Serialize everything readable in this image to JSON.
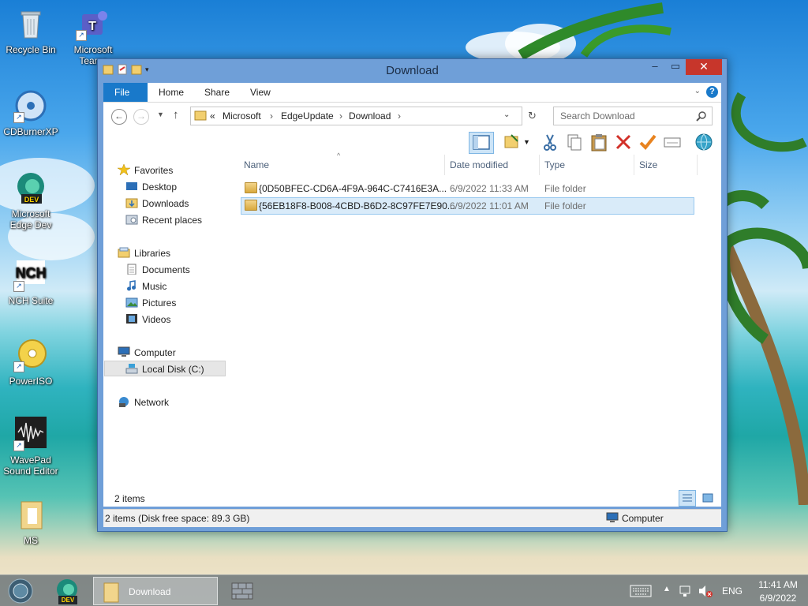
{
  "desktop": {
    "icons": [
      {
        "label": "Recycle Bin"
      },
      {
        "label": "Microsoft Teams"
      },
      {
        "label": "CDBurnerXP"
      },
      {
        "label": "Microsoft Edge Dev"
      },
      {
        "label": "NCH Suite"
      },
      {
        "label": "PowerISO"
      },
      {
        "label": "WavePad Sound Editor"
      },
      {
        "label": "MS"
      }
    ]
  },
  "window": {
    "title": "Download",
    "ribbon_tabs": [
      "File",
      "Home",
      "Share",
      "View"
    ],
    "address": {
      "prefix": "«",
      "crumbs": [
        "Microsoft",
        "EdgeUpdate",
        "Download"
      ]
    },
    "search_placeholder": "Search Download",
    "nav": {
      "favorites": "Favorites",
      "favorites_items": [
        "Desktop",
        "Downloads",
        "Recent places"
      ],
      "libraries": "Libraries",
      "libraries_items": [
        "Documents",
        "Music",
        "Pictures",
        "Videos"
      ],
      "computer": "Computer",
      "computer_items": [
        "Local Disk (C:)"
      ],
      "network": "Network"
    },
    "columns": [
      "Name",
      "Date modified",
      "Type",
      "Size"
    ],
    "files": [
      {
        "name": "{0D50BFEC-CD6A-4F9A-964C-C7416E3A...",
        "date": "6/9/2022 11:33 AM",
        "type": "File folder",
        "size": ""
      },
      {
        "name": "{56EB18F8-B008-4CBD-B6D2-8C97FE7E90...",
        "date": "6/9/2022 11:01 AM",
        "type": "File folder",
        "size": ""
      }
    ],
    "item_count": "2 items",
    "status_text": "2 items (Disk free space: 89.3 GB)",
    "status_location": "Computer"
  },
  "taskbar": {
    "active_window": "Download",
    "language": "ENG",
    "time": "11:41 AM",
    "date": "6/9/2022",
    "edge_badge": "DEV"
  }
}
